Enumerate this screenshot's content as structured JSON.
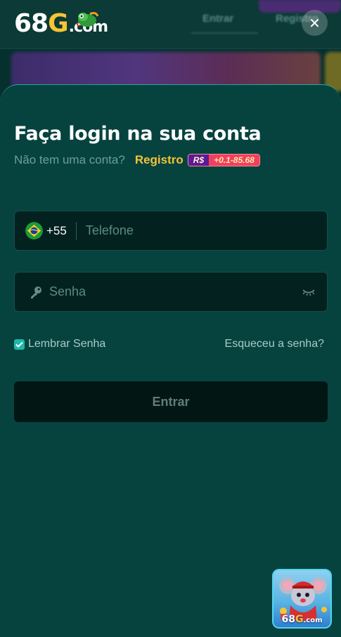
{
  "header": {
    "logo": {
      "part1": "68",
      "part2": "G",
      "part3": ".com"
    },
    "nav": [
      "Entrar",
      "Registro"
    ],
    "close_label": "✕"
  },
  "login": {
    "title": "Faça login na sua conta",
    "no_account_text": "Não tem uma conta?",
    "register_label": "Registro",
    "bonus": {
      "currency": "R$",
      "range": "+0.1-85.68"
    },
    "phone": {
      "country_code": "+55",
      "placeholder": "Telefone",
      "flag_icon": "brazil-flag-icon"
    },
    "password": {
      "placeholder": "Senha",
      "icon": "key-icon",
      "toggle_icon": "eye-closed-icon"
    },
    "remember_label": "Lembrar Senha",
    "remember_checked": true,
    "forgot_label": "Esqueceu a senha?",
    "submit_label": "Entrar"
  },
  "floating_app": {
    "logo": {
      "part1": "68",
      "part2": "G",
      "part3": ".com"
    }
  },
  "colors": {
    "background": "#06433f",
    "accent_yellow": "#f4c338",
    "accent_teal": "#1cb8aa",
    "input_bg": "#03221f"
  }
}
